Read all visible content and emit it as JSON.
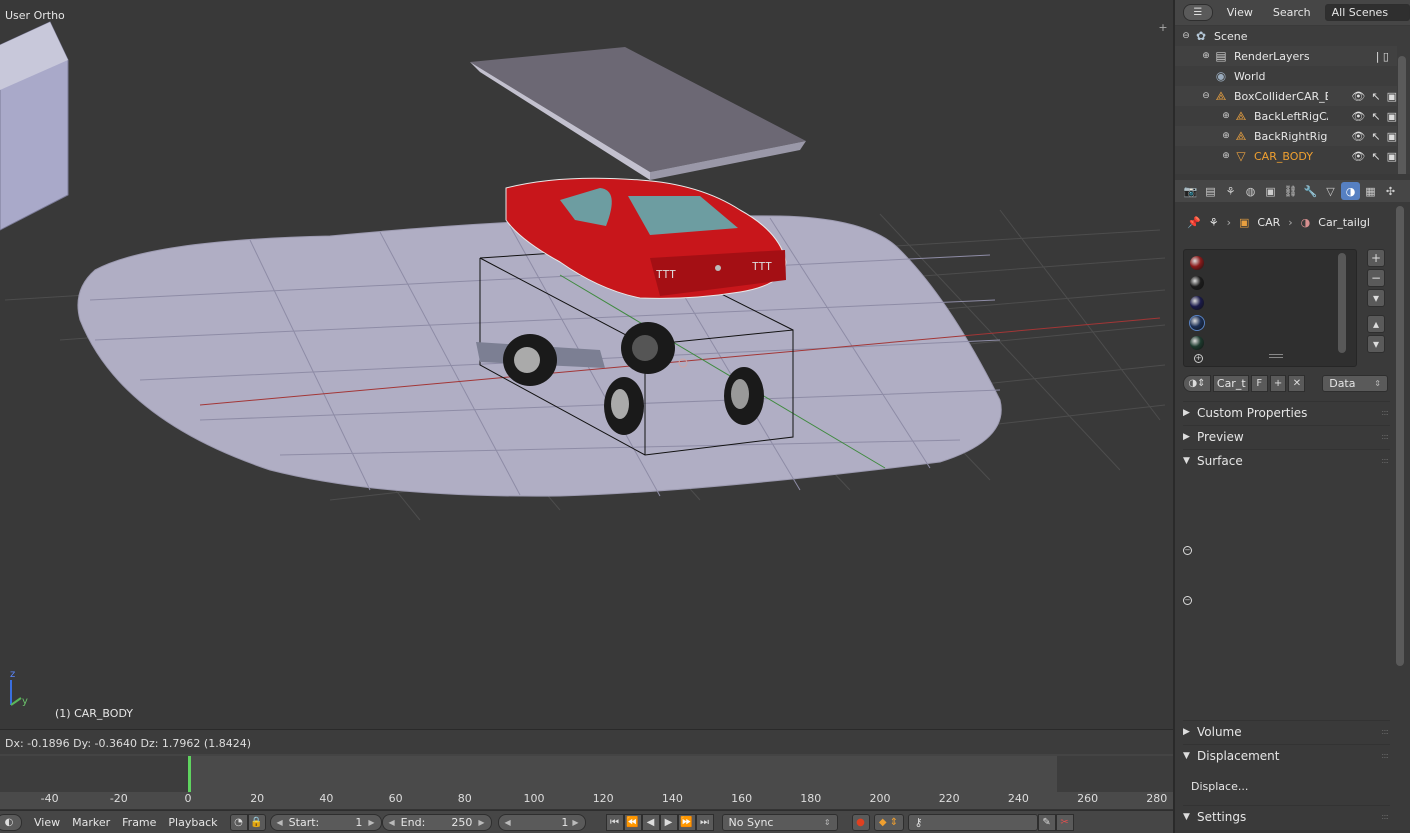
{
  "viewport": {
    "title": "User Ortho",
    "active_object": "(1) CAR_BODY",
    "status": "Dx: -0.1896  Dy: -0.3640  Dz: 1.7962 (1.8424)",
    "axis_labels": {
      "z": "z",
      "y": "y"
    }
  },
  "timeline": {
    "ticks": [
      "-40",
      "-20",
      "0",
      "20",
      "40",
      "60",
      "80",
      "100",
      "120",
      "140",
      "160",
      "180",
      "200",
      "220",
      "240",
      "260",
      "280"
    ],
    "menus": [
      "View",
      "Marker",
      "Frame",
      "Playback"
    ],
    "start_label": "Start:",
    "start_value": "1",
    "end_label": "End:",
    "end_value": "250",
    "current_frame": "1",
    "sync": "No Sync"
  },
  "outliner": {
    "menus": [
      "View",
      "Search"
    ],
    "scene_filter": "All Scenes",
    "rows": [
      {
        "name": "Scene",
        "icon": "scene-icon"
      },
      {
        "name": "RenderLayers",
        "icon": "render-layers-icon"
      },
      {
        "name": "World",
        "icon": "world-icon"
      },
      {
        "name": "BoxColliderCAR_BC",
        "icon": "empty-icon"
      },
      {
        "name": "BackLeftRigCA",
        "icon": "empty-icon"
      },
      {
        "name": "BackRightRigC",
        "icon": "empty-icon"
      },
      {
        "name": "CAR_BODY",
        "icon": "mesh-icon"
      }
    ]
  },
  "properties": {
    "context": {
      "object": "CAR",
      "material": "Car_tailgl"
    },
    "material_name": "Car_t",
    "fake_user": "F",
    "link": "Data",
    "panels": {
      "custom_properties": "Custom Properties",
      "preview": "Preview",
      "surface": "Surface",
      "volume": "Volume",
      "displacement": "Displacement",
      "displace_value": "Displace...",
      "settings": "Settings"
    },
    "slot_colors": [
      "#8a1a1a",
      "#1c1c1c",
      "#1a1a4a",
      "#1b2f55",
      "#1d3a2e"
    ]
  },
  "colors": {
    "accent": "#5680c2",
    "frame_cursor": "#5fd35f",
    "car_body": "#c8161b"
  }
}
